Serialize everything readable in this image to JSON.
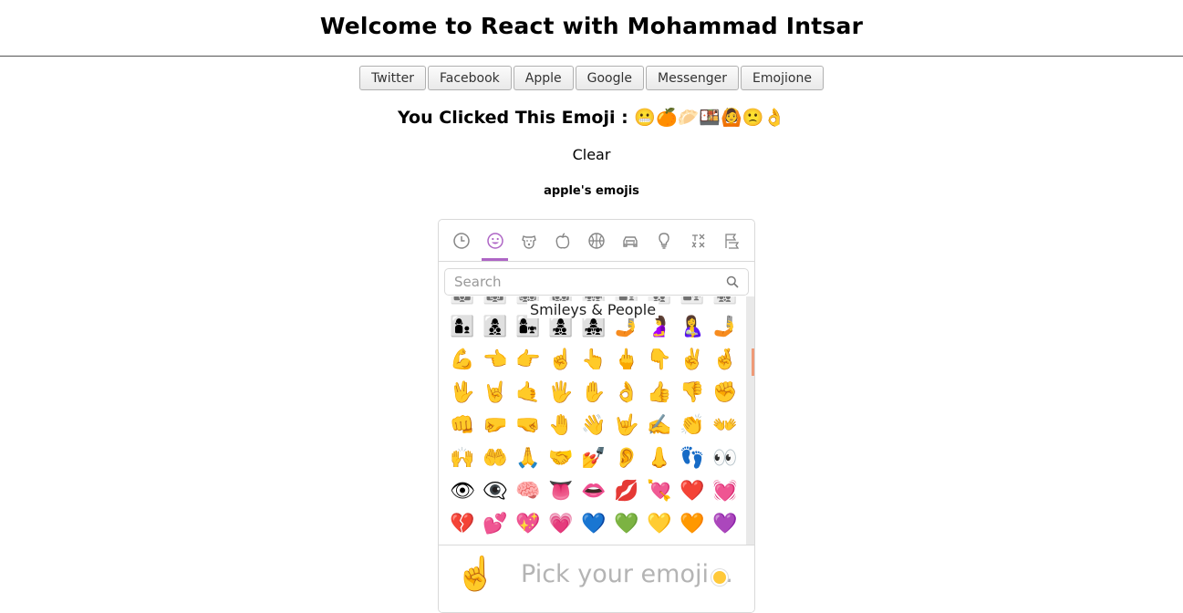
{
  "header": {
    "title": "Welcome to React with Mohammad Intsar"
  },
  "sets": [
    "Twitter",
    "Facebook",
    "Apple",
    "Google",
    "Messenger",
    "Emojione"
  ],
  "clicked": {
    "label": "You Clicked This Emoji :",
    "emojis": "😬🍊🥟🍱🙆🙁👌"
  },
  "clear_label": "Clear",
  "set_label": "apple's emojis",
  "picker": {
    "categories": [
      "recent",
      "smileys-people",
      "animals-nature",
      "food-drink",
      "activity",
      "travel-places",
      "objects",
      "symbols",
      "flags"
    ],
    "active_category": "smileys-people",
    "search_placeholder": "Search",
    "category_title": "Smileys & People",
    "rows": [
      [
        "👩‍👩‍👦",
        "👩‍👩‍👧",
        "👩‍👩‍👧‍👦",
        "👩‍👩‍👦‍👦",
        "👩‍👩‍👧‍👧",
        "👨‍👦",
        "👨‍👦‍👦",
        "👨‍👧",
        "👨‍👧‍👦"
      ],
      [
        "👩‍👦",
        "👩‍👦‍👦",
        "👩‍👧",
        "👩‍👧‍👦",
        "👩‍👧‍👧",
        "🤳",
        "🤰",
        "🤱",
        "🤳"
      ],
      [
        "💪",
        "👈",
        "👉",
        "☝️",
        "👆",
        "🖕",
        "👇",
        "✌️",
        "🤞"
      ],
      [
        "🖖",
        "🤘",
        "🤙",
        "🖐",
        "✋",
        "👌",
        "👍",
        "👎",
        "✊"
      ],
      [
        "👊",
        "🤛",
        "🤜",
        "🤚",
        "👋",
        "🤟",
        "✍️",
        "👏",
        "👐"
      ],
      [
        "🙌",
        "🤲",
        "🙏",
        "🤝",
        "💅",
        "👂",
        "👃",
        "👣",
        "👀"
      ],
      [
        "👁",
        "👁‍🗨",
        "🧠",
        "👅",
        "👄",
        "💋",
        "💘",
        "❤️",
        "💓"
      ],
      [
        "💔",
        "💕",
        "💖",
        "💗",
        "💙",
        "💚",
        "💛",
        "🧡",
        "💜"
      ]
    ],
    "preview_emoji": "☝️",
    "preview_text": "Pick your emoji…",
    "accent_color": "#ae65c5"
  }
}
